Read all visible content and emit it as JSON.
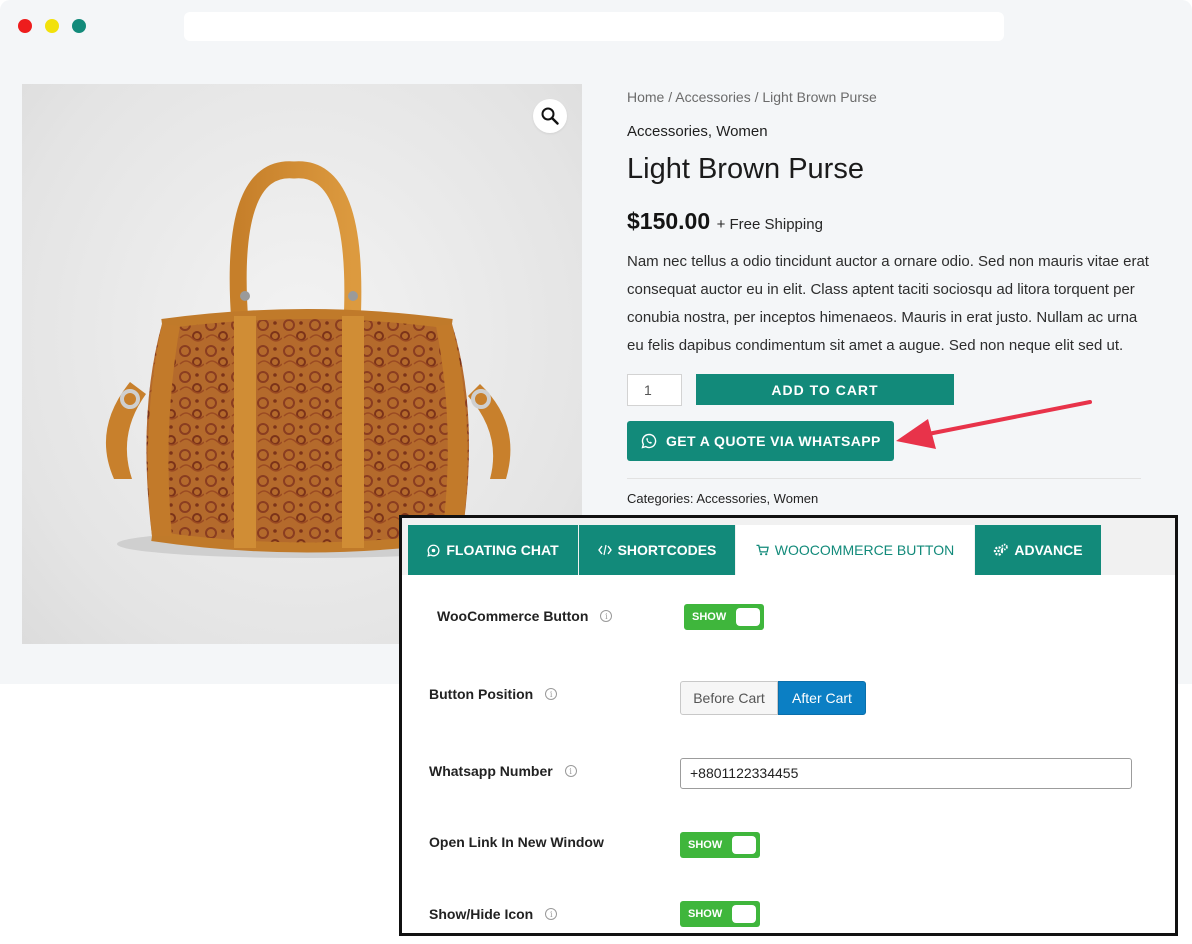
{
  "colors": {
    "brand": "#128a7a",
    "toggle_on": "#3fb63c",
    "segment_selected": "#0b7fc4",
    "arrow": "#e8334a"
  },
  "product": {
    "breadcrumb": "Home / Accessories / Light Brown Purse",
    "categories": "Accessories, Women",
    "title": "Light Brown Purse",
    "price": "$150.00",
    "shipping": "+ Free Shipping",
    "description": "Nam nec tellus a odio tincidunt auctor a ornare odio. Sed non mauris vitae erat consequat auctor eu in elit. Class aptent taciti sociosqu ad litora torquent per conubia nostra, per inceptos himenaeos. Mauris in erat justo. Nullam ac urna eu felis dapibus condimentum sit amet a augue. Sed non neque elit sed ut.",
    "quantity": "1",
    "add_to_cart_label": "ADD TO CART",
    "whatsapp_button_label": "GET A QUOTE VIA WHATSAPP",
    "categories_footer": "Categories: Accessories, Women",
    "image_icon": "zoom-icon"
  },
  "settings": {
    "tabs": [
      {
        "label": "FLOATING CHAT",
        "icon": "whatsapp-icon"
      },
      {
        "label": "SHORTCODES",
        "icon": "code-icon"
      },
      {
        "label": "WOOCOMMERCE BUTTON",
        "icon": "cart-icon",
        "active": true
      },
      {
        "label": "ADVANCE",
        "icon": "gears-icon"
      }
    ],
    "woocommerce_button_label": "WooCommerce Button",
    "woocommerce_button_toggle": "SHOW",
    "button_position_label": "Button Position",
    "position_options": [
      "Before Cart",
      "After Cart"
    ],
    "position_selected": "After Cart",
    "whatsapp_number_label": "Whatsapp Number",
    "whatsapp_number_value": "+8801122334455",
    "open_new_window_label": "Open Link In New Window",
    "open_new_window_toggle": "SHOW",
    "show_hide_icon_label": "Show/Hide Icon",
    "show_hide_icon_toggle": "SHOW",
    "info_symbol": "i"
  }
}
